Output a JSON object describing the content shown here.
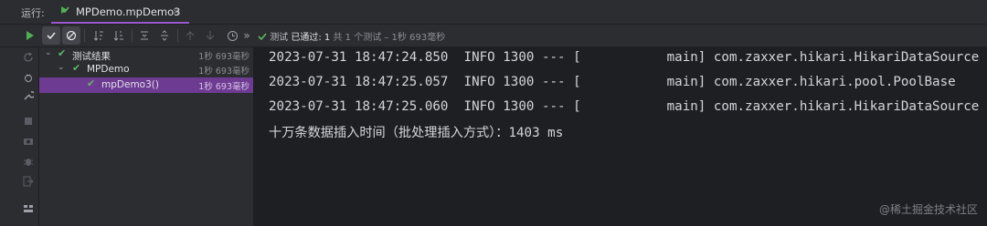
{
  "topbar": {
    "run_label": "运行:",
    "tab_title": "MPDemo.mpDemo3",
    "tab_close": "×"
  },
  "toolbar": {
    "more": "»",
    "status_prefix": "测试",
    "status_passed": "已通过: 1",
    "status_count": "共 1 个测试 – 1秒 693毫秒"
  },
  "tree": [
    {
      "label": "测试结果",
      "time": "1秒 693毫秒"
    },
    {
      "label": "MPDemo",
      "time": "1秒 693毫秒"
    },
    {
      "label": "mpDemo3()",
      "time": "1秒 693毫秒"
    }
  ],
  "console": {
    "lines": [
      "2023-07-31 18:47:24.850  INFO 1300 --- [           main] com.zaxxer.hikari.HikariDataSource",
      "2023-07-31 18:47:25.057  INFO 1300 --- [           main] com.zaxxer.hikari.pool.PoolBase",
      "2023-07-31 18:47:25.060  INFO 1300 --- [           main] com.zaxxer.hikari.HikariDataSource",
      "十万条数据插入时间（批处理插入方式）：1403 ms"
    ]
  },
  "watermark": "@稀土掘金技术社区",
  "colors": {
    "accent": "#9b59d0",
    "selection": "#6e3b93",
    "pass": "#5fb865",
    "run": "#4caf50"
  },
  "icons": [
    "run-icon",
    "check-icon",
    "stop-sign-icon",
    "sort-alpha-icon",
    "sort-duration-icon",
    "expand-all-icon",
    "collapse-all-icon",
    "arrow-up-icon",
    "arrow-down-icon",
    "history-icon",
    "chevron-more-icon"
  ]
}
